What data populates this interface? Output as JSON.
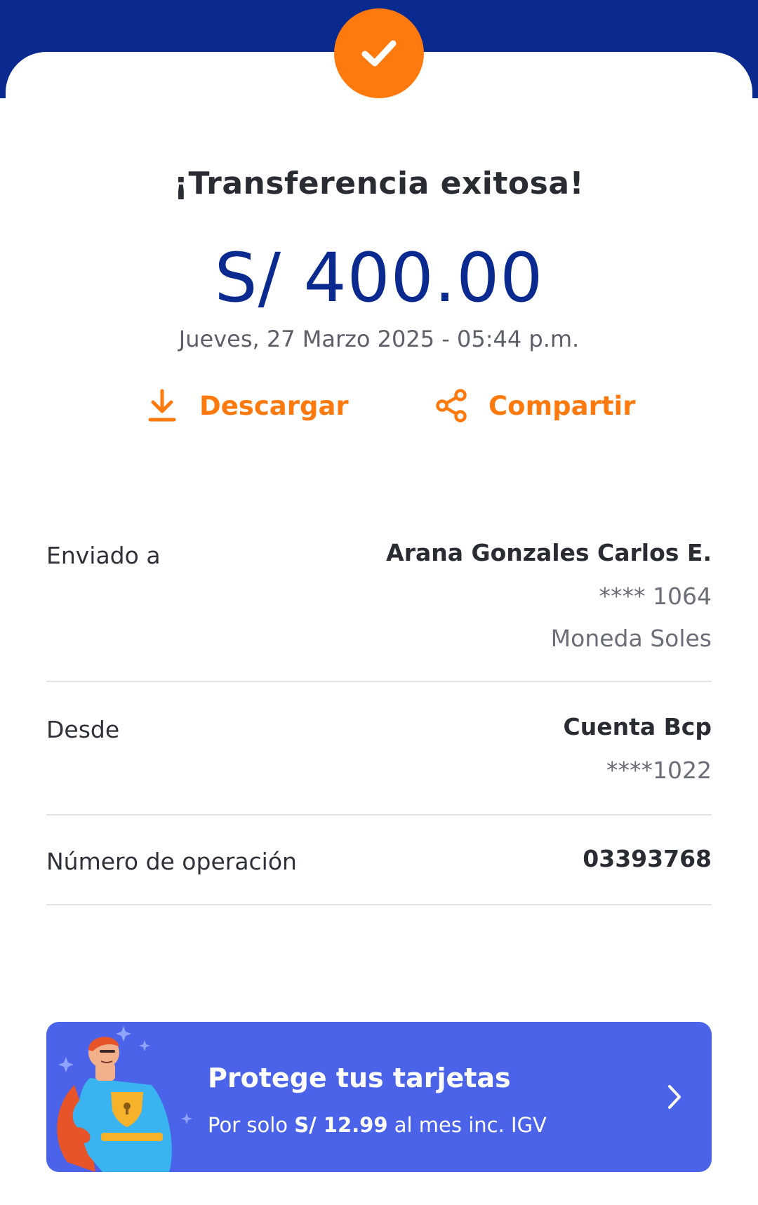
{
  "header": {
    "status_icon": "check-icon",
    "title": "¡Transferencia exitosa!",
    "amount": "S/ 400.00",
    "datetime": "Jueves, 27 Marzo 2025 - 05:44 p.m."
  },
  "actions": {
    "download_label": "Descargar",
    "share_label": "Compartir"
  },
  "details": {
    "sent_to": {
      "label": "Enviado a",
      "name": "Arana Gonzales Carlos E.",
      "account": "**** 1064",
      "currency": "Moneda Soles"
    },
    "from": {
      "label": "Desde",
      "account_name": "Cuenta Bcp",
      "account": "****1022"
    },
    "operation": {
      "label": "Número de operación",
      "number": "03393768"
    }
  },
  "promo": {
    "title": "Protege tus tarjetas",
    "sub_prefix": "Por solo ",
    "sub_price": "S/ 12.99",
    "sub_suffix": " al mes inc. IGV"
  },
  "colors": {
    "brand_blue": "#0a2a8f",
    "accent_orange": "#ff7a0e",
    "promo_blue": "#4a63e8"
  }
}
